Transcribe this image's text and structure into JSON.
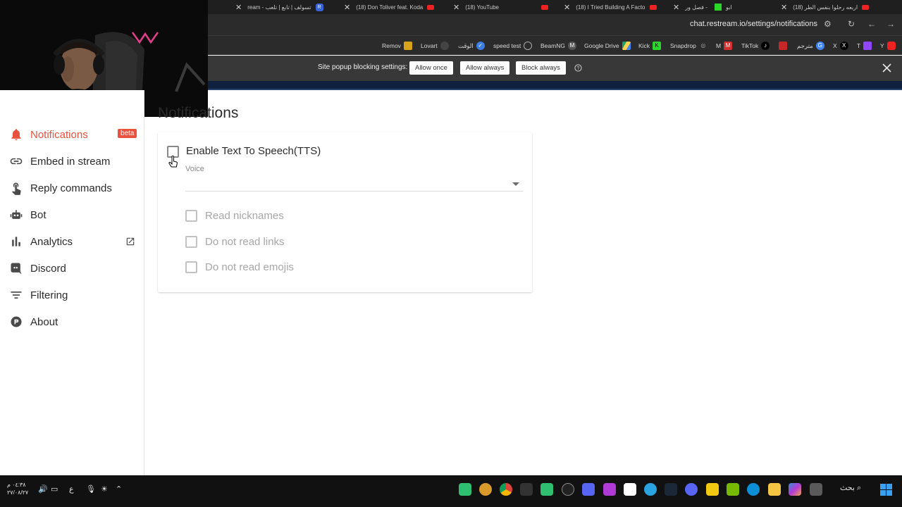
{
  "browser": {
    "tabs": [
      {
        "title": "(18) اربعه رحلوا بنفس الطر"
      },
      {
        "title": "ابو"
      },
      {
        "title": "فصل ور -"
      },
      {
        "title": "(18) I Tried Building A Facto"
      },
      {
        "title": "(18) YouTube"
      },
      {
        "title": "(18) Don Toliver feat. Koda"
      },
      {
        "title": "ream - تسولف | تابع | تلعب"
      }
    ],
    "url": "chat.restream.io/settings/notifications",
    "bookmarks": [
      {
        "label": "Remov"
      },
      {
        "label": "Lovart"
      },
      {
        "label": "الوقت"
      },
      {
        "label": "speed test"
      },
      {
        "label": "BeamNG"
      },
      {
        "label": "Google Drive"
      },
      {
        "label": "Kick"
      },
      {
        "label": "Snapdrop"
      },
      {
        "label": "M"
      },
      {
        "label": "TikTok"
      },
      {
        "label": "مترجم"
      },
      {
        "label": "X"
      },
      {
        "label": "T"
      },
      {
        "label": "Y"
      }
    ],
    "infobar": {
      "label": "Site popup blocking settings:",
      "allow_once": "Allow once",
      "allow_always": "Allow always",
      "block_always": "Block always"
    }
  },
  "sidebar": {
    "items": [
      {
        "label": "Notifications",
        "icon": "bell-icon"
      },
      {
        "label": "Embed in stream",
        "icon": "link-icon"
      },
      {
        "label": "Reply commands",
        "icon": "touch-icon"
      },
      {
        "label": "Bot",
        "icon": "robot-icon"
      },
      {
        "label": "Analytics",
        "icon": "bar-chart-icon"
      },
      {
        "label": "Discord",
        "icon": "discord-icon"
      },
      {
        "label": "Filtering",
        "icon": "filter-icon"
      },
      {
        "label": "About",
        "icon": "info-icon"
      }
    ],
    "beta": "beta"
  },
  "main": {
    "title": "Notifications",
    "tts_label": "Enable Text To Speech(TTS)",
    "voice_label": "Voice",
    "options": [
      {
        "label": "Read nicknames"
      },
      {
        "label": "Do not read links"
      },
      {
        "label": "Do not read emojis"
      }
    ]
  },
  "taskbar": {
    "time": "٠٤:٣٨ م",
    "date": "٢٧/٠٨/٢٧",
    "lang": "ع",
    "search": "بحث"
  },
  "colors": {
    "accent": "#e9523f",
    "chrome_dark": "#2b2b2b",
    "taskbar": "#111111"
  }
}
